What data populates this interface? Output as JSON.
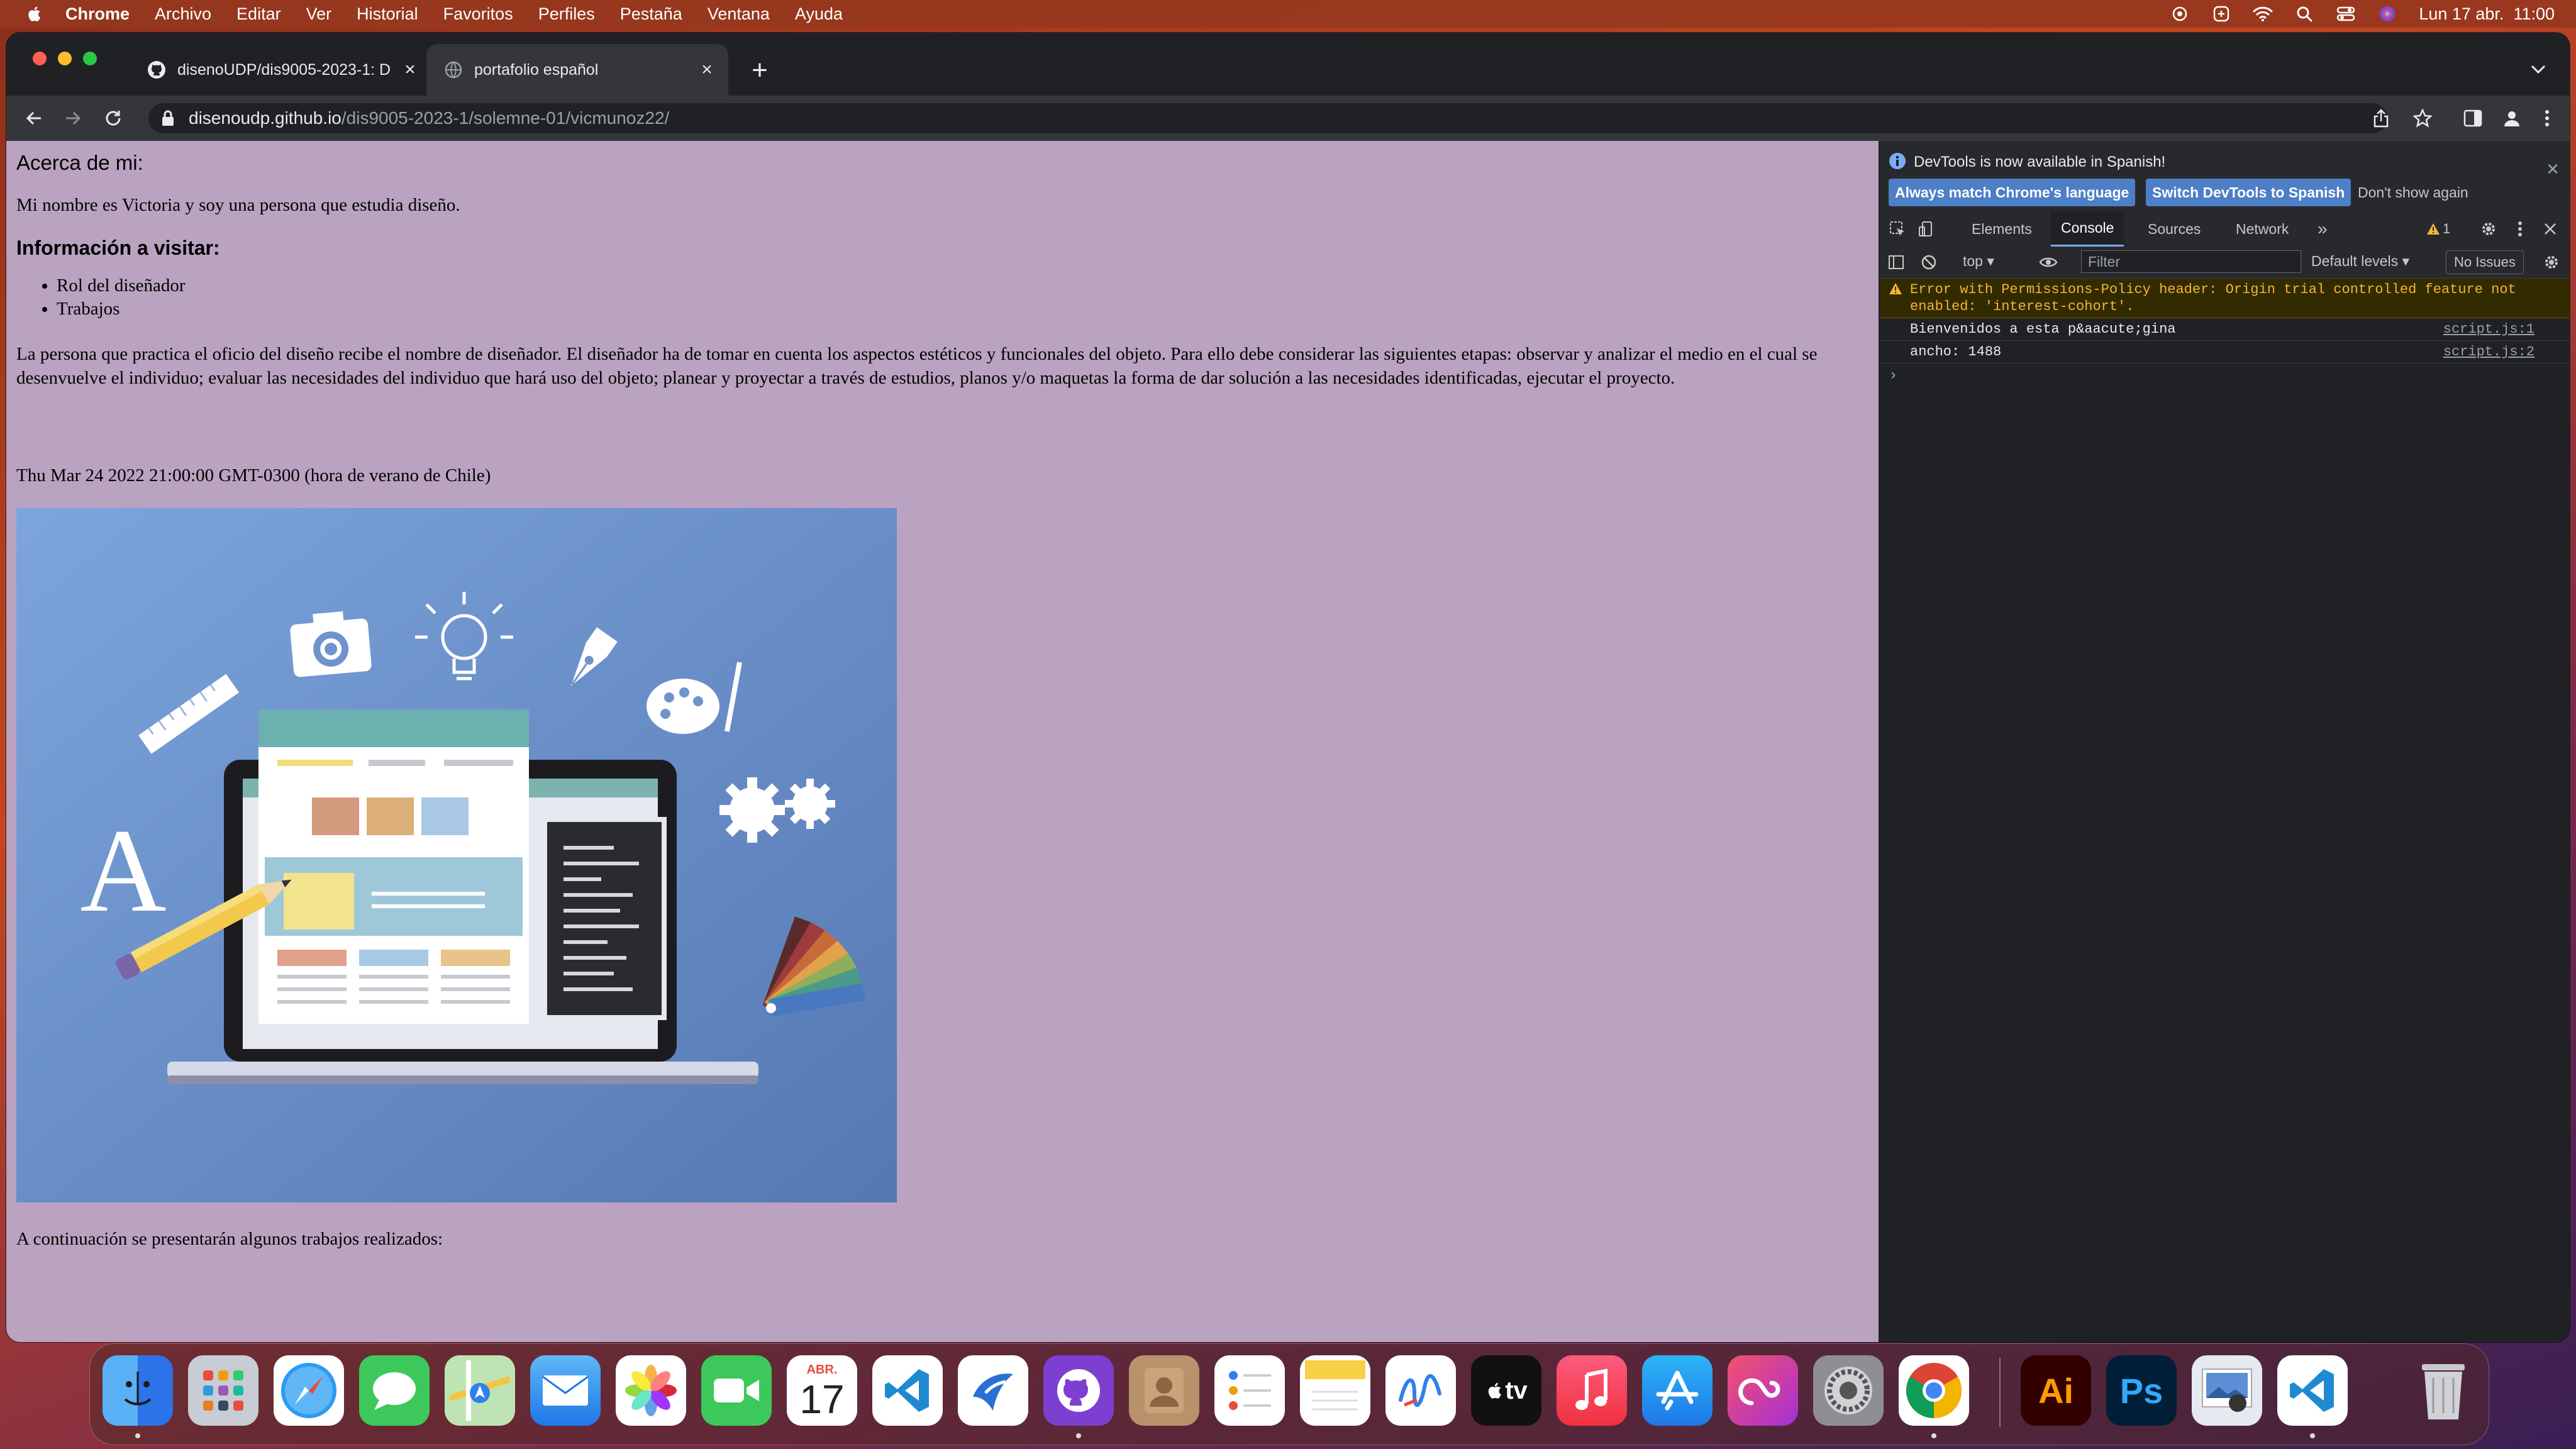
{
  "menubar": {
    "app_name": "Chrome",
    "items": [
      "Archivo",
      "Editar",
      "Ver",
      "Historial",
      "Favoritos",
      "Perfiles",
      "Pestaña",
      "Ventana",
      "Ayuda"
    ],
    "clock": "Lun 17 abr.  11:00"
  },
  "browser": {
    "tabs": [
      {
        "title": "disenoUDP/dis9005-2023-1: D",
        "icon": "github-icon"
      },
      {
        "title": "portafolio español",
        "icon": "globe-icon"
      }
    ],
    "url_host": "disenoudp.github.io",
    "url_path": "/dis9005-2023-1/solemne-01/vicmunoz22/"
  },
  "page": {
    "about_heading": "Acerca de mi:",
    "intro": "Mi nombre es Victoria y soy una persona que estudia diseño.",
    "info_heading": "Información a visitar:",
    "links": [
      "Rol del diseñador",
      "Trabajos"
    ],
    "description": "La persona que practica el oficio del diseño recibe el nombre de diseñador. El diseñador ha de tomar en cuenta los aspectos estéticos y funcionales del objeto. Para ello debe considerar las siguientes etapas: observar y analizar el medio en el cual se desenvuelve el individuo; evaluar las necesidades del individuo que hará uso del objeto; planear y proyectar a través de estudios, planos y/o maquetas la forma de dar solución a las necesidades identificadas, ejecutar el proyecto.",
    "date": "Thu Mar 24 2022 21:00:00 GMT-0300 (hora de verano de Chile)",
    "hero_letter": "A",
    "continuation": "A continuación se presentarán algunos trabajos realizados:"
  },
  "devtools": {
    "notice": "DevTools is now available in Spanish!",
    "btn_match": "Always match Chrome's language",
    "btn_switch": "Switch DevTools to Spanish",
    "btn_dont_show": "Don't show again",
    "tabs": [
      "Elements",
      "Console",
      "Sources",
      "Network"
    ],
    "more_tabs": "»",
    "warning_badge": "1",
    "context": "top ▾",
    "filter_placeholder": "Filter",
    "levels": "Default levels ▾",
    "issues": "No Issues",
    "console": [
      {
        "type": "warning",
        "text": "Error with Permissions-Policy header: Origin trial controlled feature not enabled: 'interest-cohort'.",
        "source": ""
      },
      {
        "type": "log",
        "text": "Bienvenidos a esta p&aacute;gina",
        "source": "script.js:1"
      },
      {
        "type": "log",
        "text": "ancho: 1488",
        "source": "script.js:2"
      }
    ],
    "prompt": "›"
  },
  "dock": {
    "calendar_month": "ABR.",
    "calendar_day": "17",
    "tv_label": "tv",
    "illustrator_label": "Ai",
    "photoshop_label": "Ps"
  },
  "colors": {
    "page_background": "#b9a3c0",
    "hero_background": "#6a8fc6",
    "accent_blue": "#4d7fc7",
    "warning": "#f2b33b"
  }
}
